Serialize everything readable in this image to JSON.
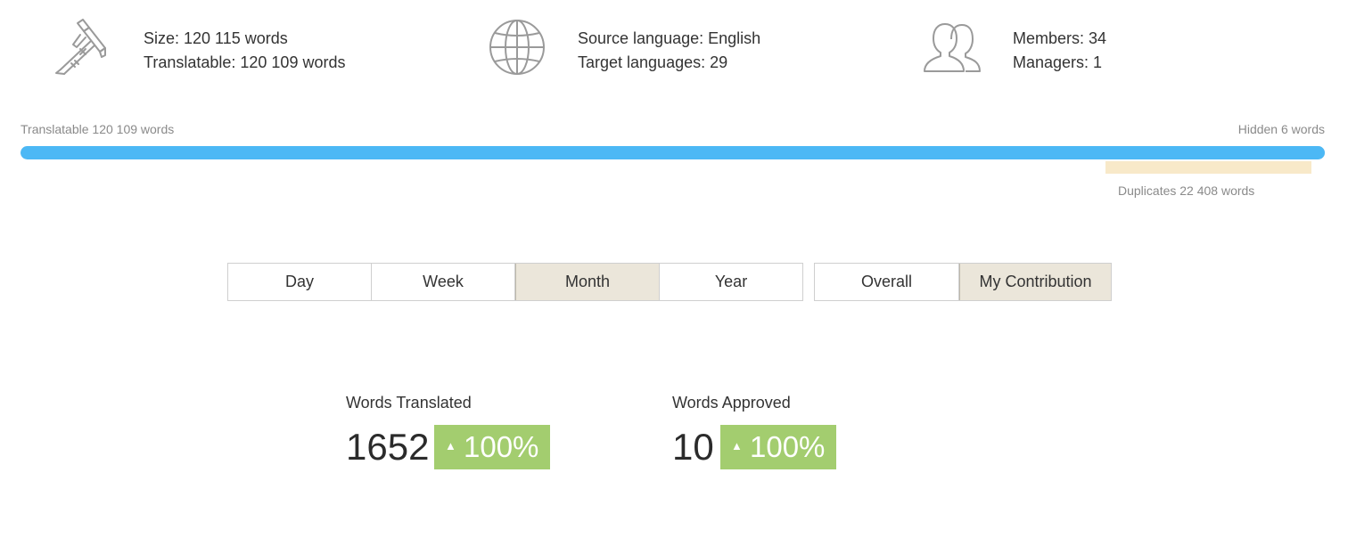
{
  "summary": {
    "size": "Size: 120 115 words",
    "translatable": "Translatable: 120 109 words",
    "source_language": "Source language: English",
    "target_languages": "Target languages: 29",
    "members": "Members: 34",
    "managers": "Managers: 1",
    "icons": [
      "caliper-icon",
      "globe-icon",
      "users-icon"
    ]
  },
  "progress": {
    "left_label": "Translatable 120 109 words",
    "right_label": "Hidden 6 words",
    "duplicates_label": "Duplicates 22 408 words",
    "translatable_fraction": 0.99995,
    "duplicates_fraction": 0.1866,
    "fill_color": "#4cb8f5",
    "duplicates_color": "#f8e9c9",
    "track_color": "#dddddd"
  },
  "period_tabs": {
    "items": [
      "Day",
      "Week",
      "Month",
      "Year"
    ],
    "active": "Month"
  },
  "scope_tabs": {
    "items": [
      "Overall",
      "My Contribution"
    ],
    "active": "My Contribution"
  },
  "stats": [
    {
      "label": "Words Translated",
      "value": "1652",
      "change": "100%",
      "arrow": "▲"
    },
    {
      "label": "Words Approved",
      "value": "10",
      "change": "100%",
      "arrow": "▲"
    }
  ],
  "colors": {
    "badge_green": "#a3cd6f",
    "active_tab_bg": "#ebe6da",
    "icon_gray": "#9a9a9a"
  }
}
